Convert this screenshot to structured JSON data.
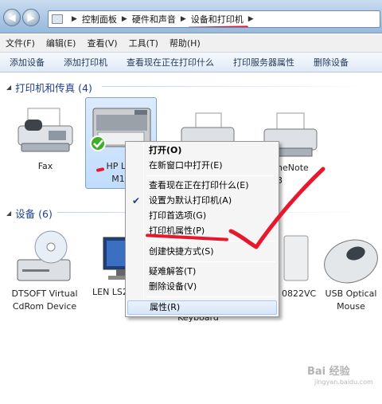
{
  "address": {
    "crumbs": [
      "控制面板",
      "硬件和声音",
      "设备和打印机"
    ]
  },
  "menubar": {
    "items": [
      "文件(F)",
      "编辑(E)",
      "查看(V)",
      "工具(T)",
      "帮助(H)"
    ]
  },
  "toolbar": {
    "items": [
      "添加设备",
      "添加打印机",
      "查看现在正在打印什么",
      "打印服务器属性",
      "删除设备"
    ]
  },
  "groups": {
    "printers": {
      "title": "打印机和传真 (4)"
    },
    "devices": {
      "title": "设备 (6)"
    }
  },
  "printers": [
    {
      "line1": "Fax",
      "line2": ""
    },
    {
      "line1": "HP Las",
      "line2": "M10"
    },
    {
      "line1": "neNote",
      "line2": "3"
    }
  ],
  "devices": [
    {
      "line1": "DTSOFT Virtual",
      "line2": "CdRom Device"
    },
    {
      "line1": "LEN LS2",
      "line2": ""
    },
    {
      "line1": "Keyboard",
      "line2": ""
    },
    {
      "line1": "0822VC",
      "line2": ""
    },
    {
      "line1": "USB Optical",
      "line2": "Mouse"
    }
  ],
  "context_menu": {
    "items": [
      "打开(O)",
      "在新窗口中打开(E)",
      "查看现在正在打印什么(E)",
      "设置为默认打印机(A)",
      "打印首选项(G)",
      "打印机属性(P)",
      "创建快捷方式(S)",
      "疑难解答(T)",
      "删除设备(V)",
      "属性(R)"
    ]
  },
  "watermark": {
    "main": "Bai 经验",
    "sub": "jingyan.baidu.com"
  },
  "colors": {
    "annotation_red": "#e8172c",
    "header_blue": "#1e3f8f",
    "menu_highlight": "#d7e6fa"
  }
}
